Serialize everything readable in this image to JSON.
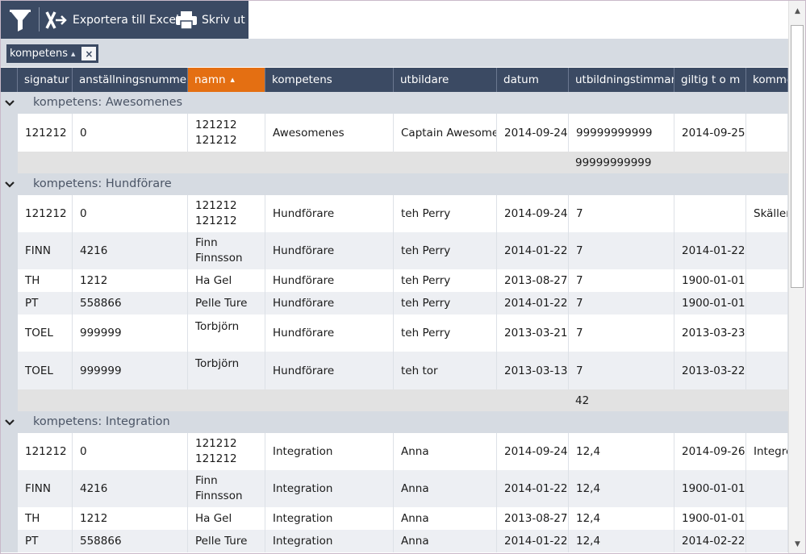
{
  "toolbar": {
    "export_label": "Exportera till Excel",
    "print_label": "Skriv ut"
  },
  "grouping": {
    "chip_label": "kompetens",
    "remove_label": "×"
  },
  "columns": [
    {
      "label": "signatur",
      "sorted": false
    },
    {
      "label": "anställningsnummer",
      "sorted": false
    },
    {
      "label": "namn",
      "sorted": true
    },
    {
      "label": "kompetens",
      "sorted": false
    },
    {
      "label": "utbildare",
      "sorted": false
    },
    {
      "label": "datum",
      "sorted": false
    },
    {
      "label": "utbildningstimmar",
      "sorted": false
    },
    {
      "label": "giltig t o m",
      "sorted": false
    },
    {
      "label": "komme",
      "sorted": false
    }
  ],
  "groups": [
    {
      "title": "kompetens: Awesomenes",
      "rows": [
        {
          "signatur": "121212",
          "anst": "0",
          "namn": [
            "121212",
            "121212"
          ],
          "kompetens": "Awesomenes",
          "utbildare": "Captain Awesome",
          "datum": "2014-09-24",
          "timmar": "99999999999",
          "giltig": "2014-09-25",
          "kommentar": ""
        }
      ],
      "total": "99999999999"
    },
    {
      "title": "kompetens: Hundförare",
      "rows": [
        {
          "signatur": "121212",
          "anst": "0",
          "namn": [
            "121212",
            "121212"
          ],
          "kompetens": "Hundförare",
          "utbildare": "teh Perry",
          "datum": "2014-09-24",
          "timmar": "7",
          "giltig": "",
          "kommentar": "Skäller"
        },
        {
          "signatur": "FINN",
          "anst": "4216",
          "namn": [
            "Finn",
            "Finnsson"
          ],
          "kompetens": "Hundförare",
          "utbildare": "teh Perry",
          "datum": "2014-01-22",
          "timmar": "7",
          "giltig": "2014-01-22",
          "kommentar": ""
        },
        {
          "signatur": "TH",
          "anst": "1212",
          "namn": [
            "Ha Gel"
          ],
          "kompetens": "Hundförare",
          "utbildare": "teh Perry",
          "datum": "2013-08-27",
          "timmar": "7",
          "giltig": "1900-01-01",
          "kommentar": ""
        },
        {
          "signatur": "PT",
          "anst": "558866",
          "namn": [
            "Pelle Ture"
          ],
          "kompetens": "Hundförare",
          "utbildare": "teh Perry",
          "datum": "2014-01-22",
          "timmar": "7",
          "giltig": "1900-01-01",
          "kommentar": ""
        },
        {
          "signatur": "TOEL",
          "anst": "999999",
          "namn": [
            "Torbjörn"
          ],
          "kompetens": "Hundförare",
          "utbildare": "teh Perry",
          "datum": "2013-03-21",
          "timmar": "7",
          "giltig": "2013-03-23",
          "kommentar": ""
        },
        {
          "signatur": "TOEL",
          "anst": "999999",
          "namn": [
            "Torbjörn"
          ],
          "kompetens": "Hundförare",
          "utbildare": "teh tor",
          "datum": "2013-03-13",
          "timmar": "7",
          "giltig": "2013-03-22",
          "kommentar": ""
        }
      ],
      "total": "42"
    },
    {
      "title": "kompetens: Integration",
      "rows": [
        {
          "signatur": "121212",
          "anst": "0",
          "namn": [
            "121212",
            "121212"
          ],
          "kompetens": "Integration",
          "utbildare": "Anna",
          "datum": "2014-09-24",
          "timmar": "12,4",
          "giltig": "2014-09-26",
          "kommentar": "Integre"
        },
        {
          "signatur": "FINN",
          "anst": "4216",
          "namn": [
            "Finn",
            "Finnsson"
          ],
          "kompetens": "Integration",
          "utbildare": "Anna",
          "datum": "2014-01-22",
          "timmar": "12,4",
          "giltig": "1900-01-01",
          "kommentar": ""
        },
        {
          "signatur": "TH",
          "anst": "1212",
          "namn": [
            "Ha Gel"
          ],
          "kompetens": "Integration",
          "utbildare": "Anna",
          "datum": "2013-08-27",
          "timmar": "12,4",
          "giltig": "1900-01-01",
          "kommentar": ""
        },
        {
          "signatur": "PT",
          "anst": "558866",
          "namn": [
            "Pelle Ture"
          ],
          "kompetens": "Integration",
          "utbildare": "Anna",
          "datum": "2014-01-22",
          "timmar": "12,4",
          "giltig": "2014-02-22",
          "kommentar": ""
        }
      ],
      "total": ""
    }
  ],
  "colors": {
    "toolbar_bg": "#3b4a63",
    "header_bg": "#3b4a63",
    "sorted_header_bg": "#e46f12",
    "group_bg": "#d6dbe2",
    "alt_row_bg": "#edeff3",
    "footer_bg": "#e2e2e2"
  }
}
